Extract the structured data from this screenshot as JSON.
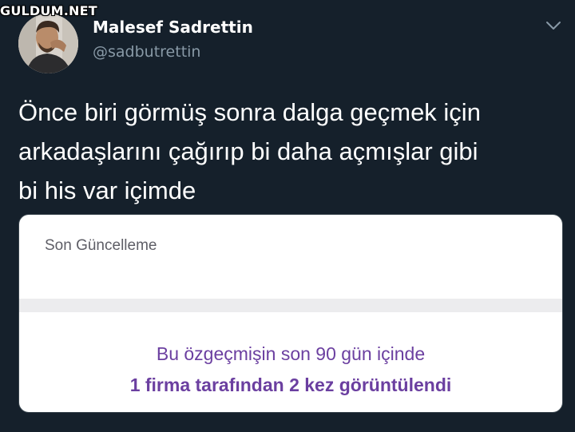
{
  "watermark": "GULDUM.NET",
  "user": {
    "display_name": "Malesef Sadrettin",
    "handle": "@sadbutrettin"
  },
  "tweet": {
    "lines": [
      "Önce biri görmüş sonra dalga geçmek için",
      "arkadaşlarını çağırıp bi daha açmışlar gibi",
      "bi his var içimde"
    ]
  },
  "card": {
    "label": "Son Güncelleme",
    "message_line1": "Bu özgeçmişin son 90 gün içinde",
    "message_line2": "1 firma tarafından 2 kez görüntülendi"
  },
  "colors": {
    "background": "#15202b",
    "secondary_text": "#8899a6",
    "card_accent": "#6b3fa0"
  },
  "icons": {
    "menu": "chevron-down-icon"
  }
}
